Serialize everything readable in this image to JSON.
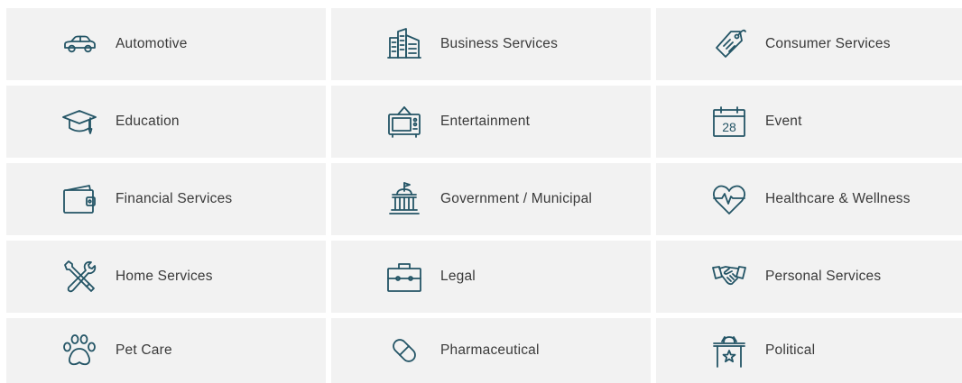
{
  "services": {
    "automotive": {
      "label": "Automotive",
      "icon": "car-icon"
    },
    "business": {
      "label": "Business Services",
      "icon": "office-building-icon"
    },
    "consumer": {
      "label": "Consumer Services",
      "icon": "price-tag-icon"
    },
    "education": {
      "label": "Education",
      "icon": "graduation-cap-icon"
    },
    "entertainment": {
      "label": "Entertainment",
      "icon": "television-icon"
    },
    "event": {
      "label": "Event",
      "icon": "calendar-icon",
      "calendar_day": "28"
    },
    "financial": {
      "label": "Financial Services",
      "icon": "wallet-icon"
    },
    "government": {
      "label": "Government / Municipal",
      "icon": "government-building-icon"
    },
    "healthcare": {
      "label": "Healthcare & Wellness",
      "icon": "heartbeat-icon"
    },
    "home": {
      "label": "Home Services",
      "icon": "tools-icon"
    },
    "legal": {
      "label": "Legal",
      "icon": "briefcase-icon"
    },
    "personal": {
      "label": "Personal Services",
      "icon": "handshake-icon"
    },
    "pet": {
      "label": "Pet Care",
      "icon": "paw-print-icon"
    },
    "pharma": {
      "label": "Pharmaceutical",
      "icon": "pill-capsule-icon"
    },
    "political": {
      "label": "Political",
      "icon": "podium-icon"
    }
  },
  "colors": {
    "tile_background": "#f2f2f2",
    "icon_stroke": "#245566",
    "label_text": "#3a3a3a"
  }
}
